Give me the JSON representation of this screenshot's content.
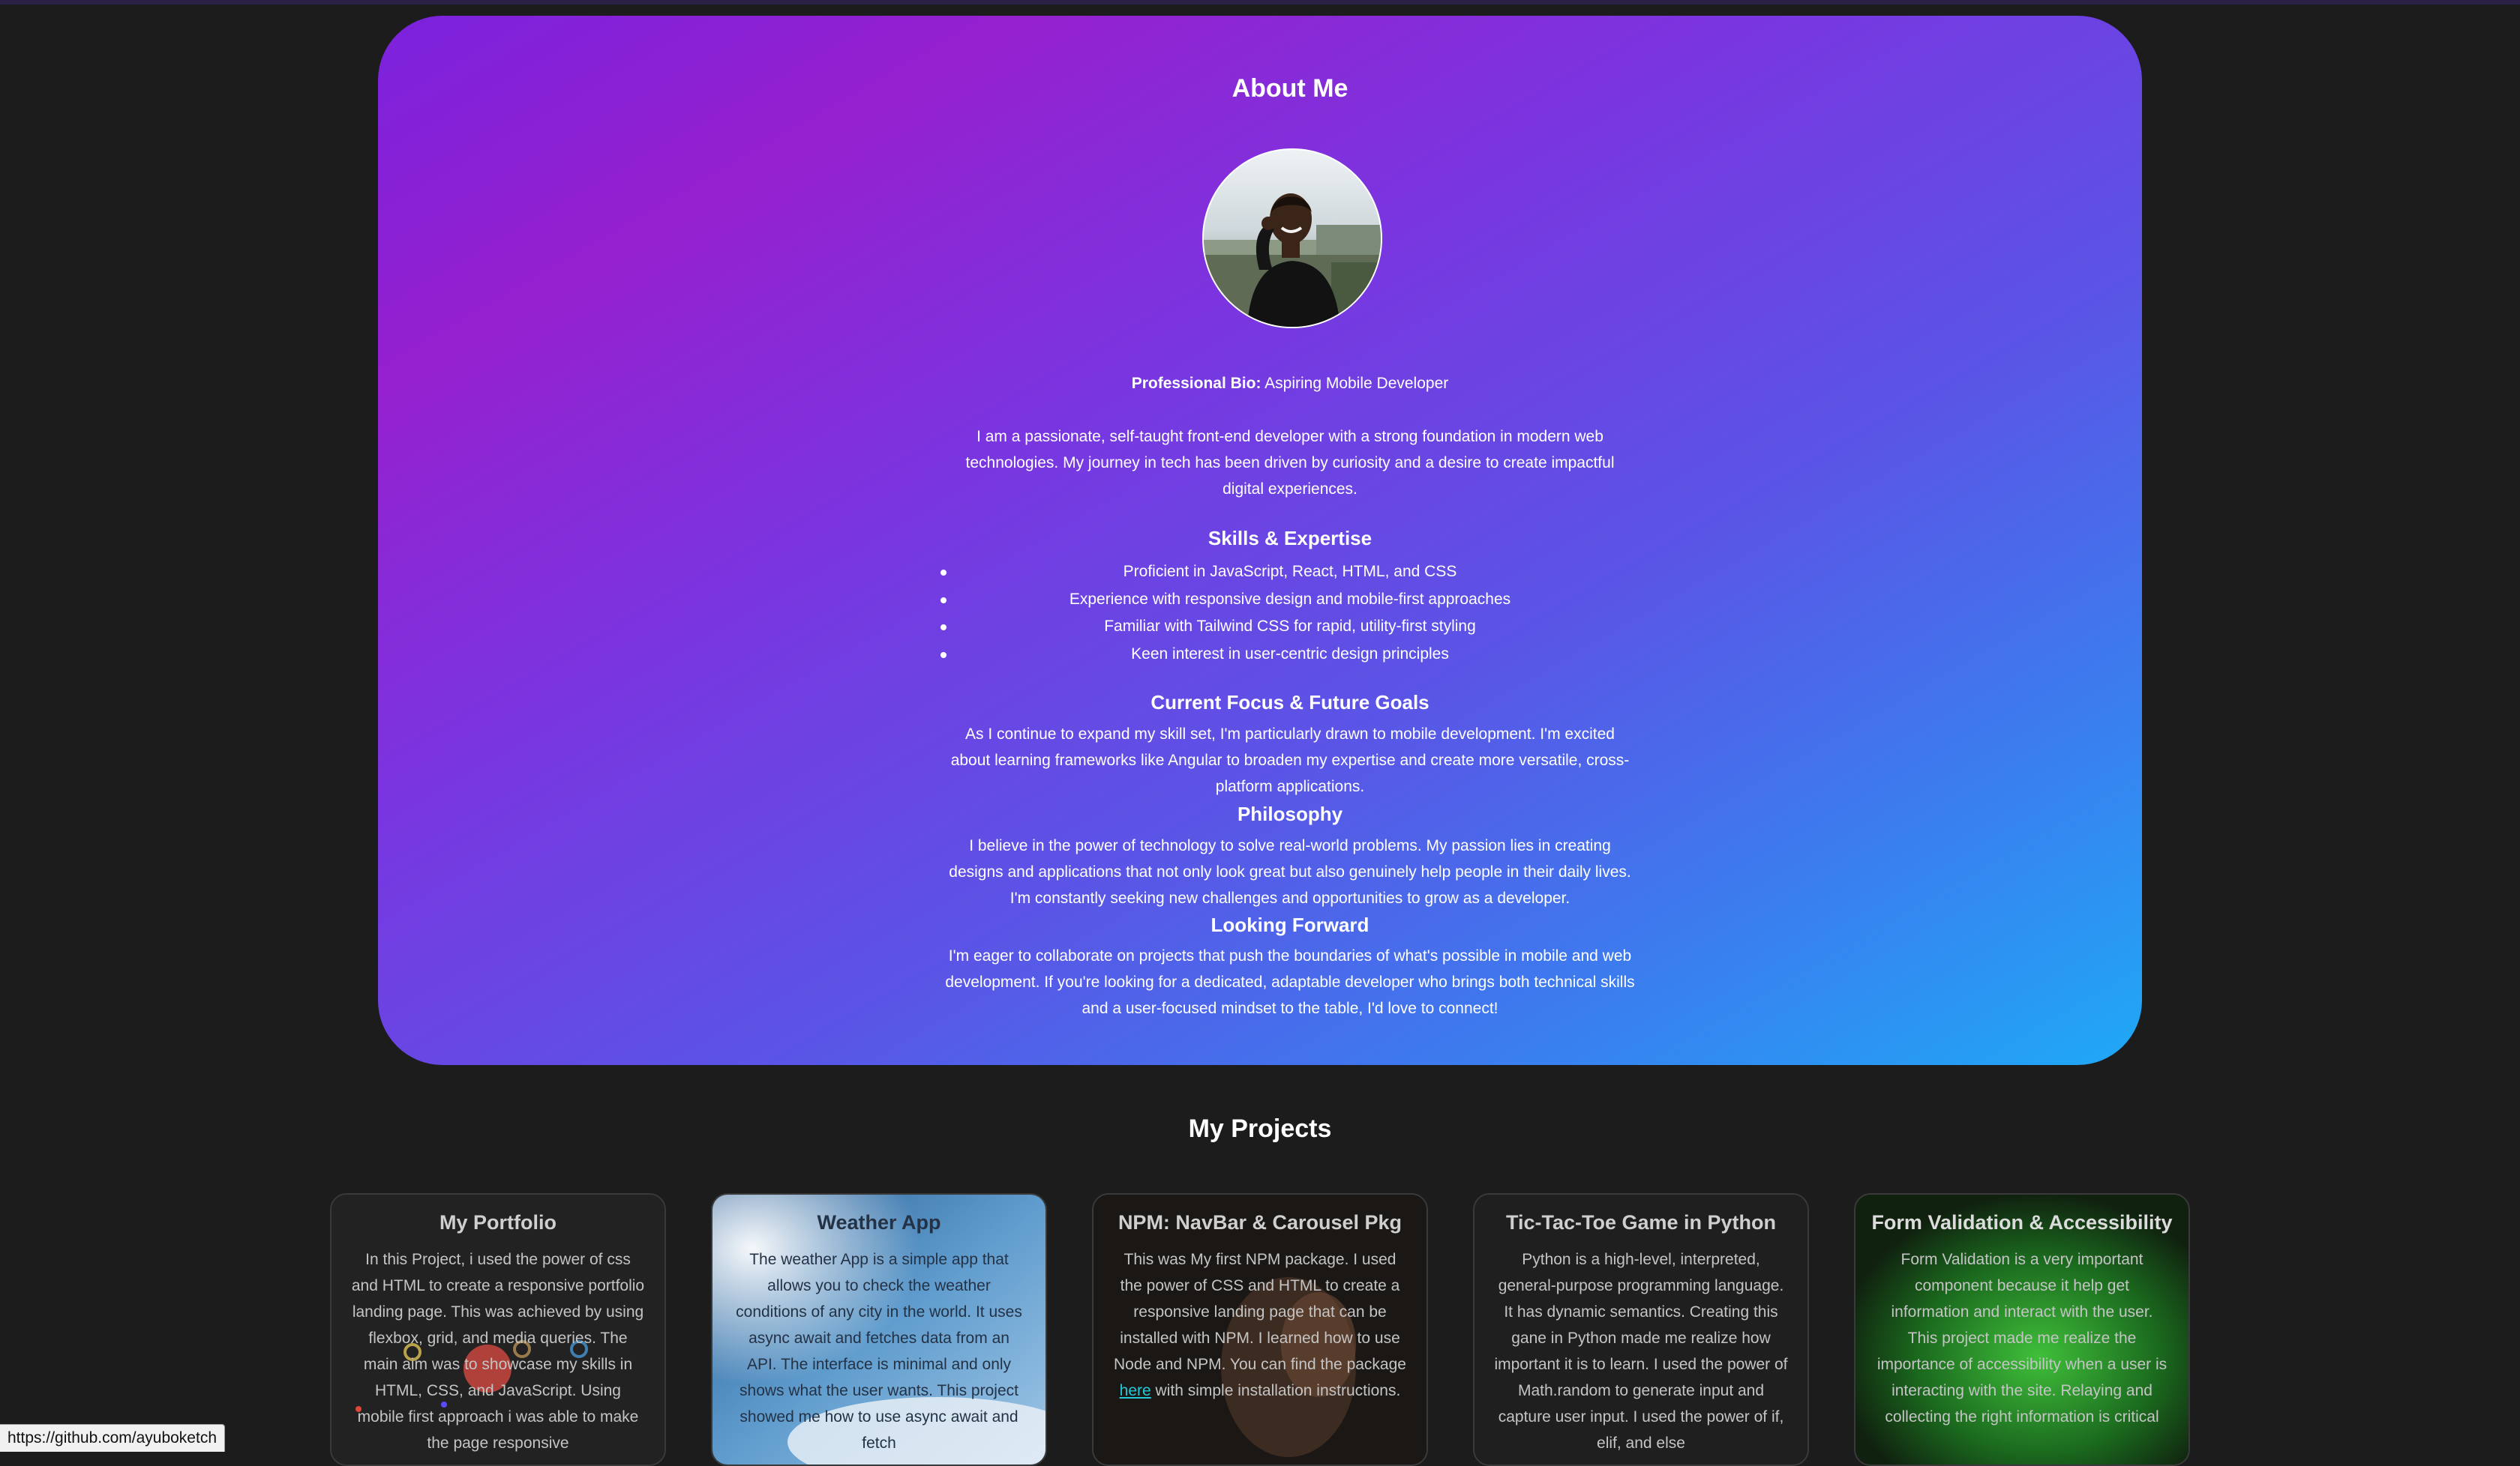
{
  "about": {
    "title": "About Me",
    "bio_label": "Professional Bio:",
    "bio_value": " Aspiring Mobile Developer",
    "intro": "I am a passionate, self-taught front-end developer with a strong foundation in modern web technologies. My journey in tech has been driven by curiosity and a desire to create impactful digital experiences.",
    "skills_heading": "Skills & Expertise",
    "skills": [
      "Proficient in JavaScript, React, HTML, and CSS",
      "Experience with responsive design and mobile-first approaches",
      "Familiar with Tailwind CSS for rapid, utility-first styling",
      "Keen interest in user-centric design principles"
    ],
    "focus_heading": "Current Focus & Future Goals",
    "focus_text": "As I continue to expand my skill set, I'm particularly drawn to mobile development. I'm excited about learning frameworks like Angular to broaden my expertise and create more versatile, cross-platform applications.",
    "philosophy_heading": "Philosophy",
    "philosophy_text": "I believe in the power of technology to solve real-world problems. My passion lies in creating designs and applications that not only look great but also genuinely help people in their daily lives. I'm constantly seeking new challenges and opportunities to grow as a developer.",
    "forward_heading": "Looking Forward",
    "forward_text": "I'm eager to collaborate on projects that push the boundaries of what's possible in mobile and web development. If you're looking for a dedicated, adaptable developer who brings both technical skills and a user-focused mindset to the table, I'd love to connect!"
  },
  "projects": {
    "title": "My Projects",
    "cards": [
      {
        "title": "My Portfolio",
        "text": "In this Project, i used the power of css and HTML to create a responsive portfolio landing page. This was achieved by using flexbox, grid, and media queries. The main aim was to showcase my skills in HTML, CSS, and JavaScript. Using mobile first approach i was able to make the page responsive"
      },
      {
        "title": "Weather App",
        "text": "The weather App is a simple app that allows you to check the weather conditions of any city in the world. It uses async await and fetches data from an API. The interface is minimal and only shows what the user wants. This project showed me how to use async await and fetch"
      },
      {
        "title": "NPM: NavBar & Carousel Pkg",
        "text_before": "This was My first NPM package. I used the power of CSS and HTML to create a responsive landing page that can be installed with NPM. I learned how to use Node and NPM. You can find the package ",
        "link": "here",
        "text_after": " with simple installation instructions."
      },
      {
        "title": "Tic-Tac-Toe Game in Python",
        "text": "Python is a high-level, interpreted, general-purpose programming language. It has dynamic semantics. Creating this gane in Python made me realize how important it is to learn. I used the power of Math.random to generate input and capture user input. I used the power of if, elif, and else"
      },
      {
        "title": "Form Validation & Accessibility",
        "text": "Form Validation is a very important component because it help get information and interact with the user. This project made me realize the importance of accessibility when a user is interacting with the site. Relaying and collecting the right information is critical"
      }
    ]
  },
  "status_bar": {
    "url": "https://github.com/ayuboketch"
  }
}
